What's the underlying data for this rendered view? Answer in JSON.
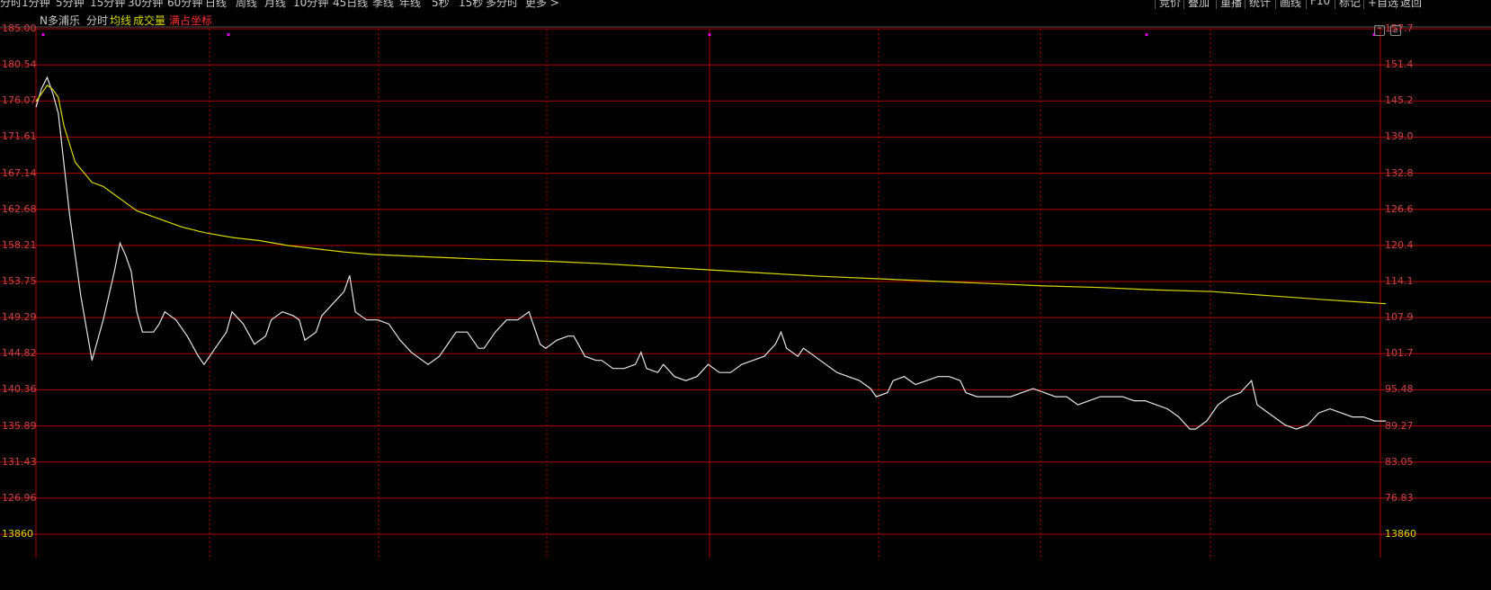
{
  "toolbar": {
    "tabs": [
      "分时",
      "1分钟",
      "5分钟",
      "15分钟",
      "30分钟",
      "60分钟",
      "日线",
      "周线",
      "月线",
      "10分钟",
      "45日线",
      "季线",
      "年线",
      "5秒",
      "15秒",
      "多分时",
      "更多 >"
    ],
    "buttons": [
      "竞价",
      "叠加",
      "重播",
      "统计",
      "画线",
      "F10",
      "标记",
      "+自选",
      "返回"
    ]
  },
  "title": {
    "stock_name": "N多浦乐",
    "mode": "分时",
    "avg_label": "均线",
    "volume_label": "成交量",
    "scale_label": "满占坐标"
  },
  "colors": {
    "background": "#000000",
    "grid": "#b00000",
    "price_line": "#e6e6e6",
    "avg_line": "#d8d800",
    "left_axis_text": "#c84646",
    "right_axis_text": "#c84646",
    "bottom_left_label": "#d8d800"
  },
  "chart_data": {
    "type": "line",
    "title": "",
    "xlabel": "",
    "ylabel": "",
    "ylim": [
      122.5,
      185.0
    ],
    "left_ticks": [
      "185.00",
      "180.54",
      "176.07",
      "171.61",
      "167.14",
      "162.68",
      "158.21",
      "153.75",
      "149.29",
      "144.82",
      "140.36",
      "135.89",
      "131.43",
      "126.96",
      "13860"
    ],
    "right_ticks": [
      "157.7",
      "151.4",
      "145.2",
      "139.0",
      "132.8",
      "126.6",
      "120.4",
      "114.1",
      "107.9",
      "101.7",
      "95.48",
      "89.27",
      "83.05",
      "76.83",
      "13860"
    ],
    "x_count": 241,
    "grid": true,
    "series": [
      {
        "key": "price",
        "points": [
          [
            0,
            175.3
          ],
          [
            1,
            177.6
          ],
          [
            2,
            179.0
          ],
          [
            3,
            177.0
          ],
          [
            4,
            174.5
          ],
          [
            6,
            162.0
          ],
          [
            8,
            152.0
          ],
          [
            10,
            144.0
          ],
          [
            12,
            149.0
          ],
          [
            14,
            155.0
          ],
          [
            15,
            158.5
          ],
          [
            16,
            157.0
          ],
          [
            17,
            155.0
          ],
          [
            18,
            150.0
          ],
          [
            19,
            147.5
          ],
          [
            20,
            147.5
          ],
          [
            21,
            147.5
          ],
          [
            22,
            148.5
          ],
          [
            23,
            150.0
          ],
          [
            24,
            149.5
          ],
          [
            25,
            149.0
          ],
          [
            27,
            147.0
          ],
          [
            29,
            144.5
          ],
          [
            30,
            143.5
          ],
          [
            32,
            145.5
          ],
          [
            34,
            147.5
          ],
          [
            35,
            150.0
          ],
          [
            37,
            148.5
          ],
          [
            39,
            146.0
          ],
          [
            41,
            147.0
          ],
          [
            42,
            149.0
          ],
          [
            44,
            150.0
          ],
          [
            46,
            149.5
          ],
          [
            47,
            149.0
          ],
          [
            48,
            146.5
          ],
          [
            50,
            147.5
          ],
          [
            51,
            149.5
          ],
          [
            53,
            151.0
          ],
          [
            55,
            152.5
          ],
          [
            56,
            154.5
          ],
          [
            57,
            150.0
          ],
          [
            59,
            149.0
          ],
          [
            61,
            149.0
          ],
          [
            63,
            148.5
          ],
          [
            65,
            146.5
          ],
          [
            67,
            145.0
          ],
          [
            68,
            144.5
          ],
          [
            70,
            143.5
          ],
          [
            72,
            144.5
          ],
          [
            74,
            146.5
          ],
          [
            75,
            147.5
          ],
          [
            77,
            147.5
          ],
          [
            79,
            145.5
          ],
          [
            80,
            145.5
          ],
          [
            82,
            147.5
          ],
          [
            84,
            149.0
          ],
          [
            86,
            149.0
          ],
          [
            88,
            150.0
          ],
          [
            90,
            146.0
          ],
          [
            91,
            145.5
          ],
          [
            93,
            146.5
          ],
          [
            95,
            147.0
          ],
          [
            96,
            147.0
          ],
          [
            98,
            144.5
          ],
          [
            100,
            144.0
          ],
          [
            101,
            144.0
          ],
          [
            103,
            143.0
          ],
          [
            105,
            143.0
          ],
          [
            107,
            143.5
          ],
          [
            108,
            145.0
          ],
          [
            109,
            143.0
          ],
          [
            111,
            142.5
          ],
          [
            112,
            143.5
          ],
          [
            114,
            142.0
          ],
          [
            116,
            141.5
          ],
          [
            118,
            142.0
          ],
          [
            120,
            143.5
          ],
          [
            122,
            142.5
          ],
          [
            124,
            142.5
          ],
          [
            126,
            143.5
          ],
          [
            128,
            144.0
          ],
          [
            130,
            144.5
          ],
          [
            132,
            146.0
          ],
          [
            133,
            147.5
          ],
          [
            134,
            145.5
          ],
          [
            136,
            144.5
          ],
          [
            137,
            145.5
          ],
          [
            139,
            144.5
          ],
          [
            141,
            143.5
          ],
          [
            143,
            142.5
          ],
          [
            145,
            142.0
          ],
          [
            147,
            141.5
          ],
          [
            149,
            140.5
          ],
          [
            150,
            139.5
          ],
          [
            152,
            140.0
          ],
          [
            153,
            141.5
          ],
          [
            155,
            142.0
          ],
          [
            157,
            141.0
          ],
          [
            159,
            141.5
          ],
          [
            161,
            142.0
          ],
          [
            163,
            142.0
          ],
          [
            165,
            141.5
          ],
          [
            166,
            140.0
          ],
          [
            168,
            139.5
          ],
          [
            170,
            139.5
          ],
          [
            172,
            139.5
          ],
          [
            174,
            139.5
          ],
          [
            176,
            140.0
          ],
          [
            178,
            140.5
          ],
          [
            180,
            140.0
          ],
          [
            182,
            139.5
          ],
          [
            184,
            139.5
          ],
          [
            186,
            138.5
          ],
          [
            188,
            139.0
          ],
          [
            190,
            139.5
          ],
          [
            192,
            139.5
          ],
          [
            194,
            139.5
          ],
          [
            196,
            139.0
          ],
          [
            198,
            139.0
          ],
          [
            200,
            138.5
          ],
          [
            202,
            138.0
          ],
          [
            204,
            137.0
          ],
          [
            206,
            135.5
          ],
          [
            207,
            135.5
          ],
          [
            209,
            136.5
          ],
          [
            211,
            138.5
          ],
          [
            213,
            139.5
          ],
          [
            215,
            140.0
          ],
          [
            217,
            141.5
          ],
          [
            218,
            138.5
          ],
          [
            220,
            137.5
          ],
          [
            222,
            136.5
          ],
          [
            223,
            136.0
          ],
          [
            225,
            135.5
          ],
          [
            227,
            136.0
          ],
          [
            229,
            137.5
          ],
          [
            231,
            138.0
          ],
          [
            233,
            137.5
          ],
          [
            235,
            137.0
          ],
          [
            237,
            137.0
          ],
          [
            239,
            136.5
          ],
          [
            241,
            136.5
          ]
        ]
      },
      {
        "key": "avg",
        "points": [
          [
            0,
            176.0
          ],
          [
            2,
            178.0
          ],
          [
            3,
            177.5
          ],
          [
            4,
            176.5
          ],
          [
            5,
            173.0
          ],
          [
            7,
            168.5
          ],
          [
            10,
            166.0
          ],
          [
            12,
            165.5
          ],
          [
            15,
            164.0
          ],
          [
            18,
            162.5
          ],
          [
            22,
            161.5
          ],
          [
            26,
            160.5
          ],
          [
            30,
            159.8
          ],
          [
            35,
            159.2
          ],
          [
            40,
            158.8
          ],
          [
            45,
            158.2
          ],
          [
            50,
            157.8
          ],
          [
            55,
            157.4
          ],
          [
            60,
            157.1
          ],
          [
            70,
            156.8
          ],
          [
            80,
            156.5
          ],
          [
            90,
            156.3
          ],
          [
            100,
            156.0
          ],
          [
            110,
            155.6
          ],
          [
            120,
            155.2
          ],
          [
            130,
            154.8
          ],
          [
            140,
            154.4
          ],
          [
            150,
            154.1
          ],
          [
            160,
            153.8
          ],
          [
            170,
            153.5
          ],
          [
            180,
            153.2
          ],
          [
            190,
            153.0
          ],
          [
            200,
            152.7
          ],
          [
            210,
            152.5
          ],
          [
            220,
            152.0
          ],
          [
            230,
            151.5
          ],
          [
            241,
            151.0
          ]
        ]
      }
    ]
  }
}
